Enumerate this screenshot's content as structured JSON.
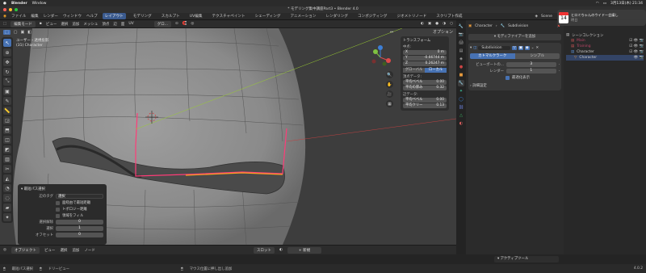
{
  "mac_menu": {
    "app": "Blender",
    "window": "Window",
    "date": "3月13日(木) 21:34"
  },
  "window_title": "* モデリング集中講座Part3 • Blender 4.0",
  "menu": {
    "file": "ファイル",
    "edit": "編集",
    "render": "レンダー",
    "window": "ウィンドウ",
    "help": "ヘルプ"
  },
  "workspaces": [
    "レイアウト",
    "モデリング",
    "スカルプト",
    "UV編集",
    "テクスチャペイント",
    "シェーディング",
    "アニメーション",
    "レンダリング",
    "コンポジティング",
    "ジオメトリノード",
    "スクリプト作成"
  ],
  "active_workspace": 0,
  "scene": "Scene",
  "notification": {
    "day": "14",
    "title": "ヒロミちゃんのウイドー会議し",
    "sub": "明日"
  },
  "viewport_header": {
    "mode": "編集モード",
    "menus": [
      "ビュー",
      "選択",
      "追加",
      "メッシュ",
      "頂点",
      "辺",
      "面",
      "UV"
    ],
    "orientation": "グロ..."
  },
  "viewport_info": {
    "line1": "ユーザー・透視投影",
    "line2": "(31) Character"
  },
  "options_label": "オプション",
  "tools": [
    "cursor",
    "select",
    "move",
    "rotate",
    "scale",
    "transform",
    "annotate",
    "measure",
    "add-cube",
    "extrude",
    "inset",
    "bevel",
    "loopcut",
    "knife",
    "polybuild",
    "spin",
    "smooth",
    "shear",
    "rip"
  ],
  "n_panel": {
    "header": "トランスフォーム",
    "median_label": "中点:",
    "x_label": "X",
    "x_value": "0 m",
    "y_label": "Y",
    "y_value": "-0.66744 m",
    "z_label": "Z",
    "z_value": "0.26247 m",
    "global": "グローバル",
    "local": "ローカル",
    "vertex_data": "頂点データ:",
    "v_bevel_label": "平均ベベル",
    "v_bevel_value": "0.00",
    "v_crease_label": "平均の厚み",
    "v_crease_value": "0.32",
    "edge_data": "辺データ:",
    "e_bevel_label": "平均ベベル",
    "e_bevel_value": "0.00",
    "e_crease_label": "平均クリー",
    "e_crease_value": "0.13"
  },
  "op_panel": {
    "title": "最短パス選択",
    "edge_tag_label": "辺のタグ",
    "edge_tag_value": "選択",
    "opt1": "面経由で最短距離",
    "opt2": "トポロジー距離",
    "opt3": "領域をフィル",
    "deselect_label": "選択解除",
    "deselect_value": "0",
    "select_label": "選択",
    "select_value": "1",
    "offset_label": "オフセット",
    "offset_value": "0"
  },
  "bottom_header": {
    "mode": "オブジェクト",
    "menus": [
      "ビュー",
      "選択",
      "追加",
      "ノード"
    ],
    "slot": "スロット",
    "new": "新規"
  },
  "active_tool": "アクティブツール",
  "status": {
    "item1": "最短パス選択",
    "item2": "ドリービュー",
    "item3": "マウス位置に押し出し追加",
    "version": "4.0.2"
  },
  "properties": {
    "object": "Character",
    "modifier_name": "Subdivision",
    "add_modifier": "モディファイアーを追加",
    "catmull": "カトマルクラーク",
    "simple": "シンプル",
    "levels_viewport_label": "ビューポートの...",
    "levels_viewport_value": "3",
    "render_label": "レンダー",
    "render_value": "1",
    "optimal_label": "最適化表示",
    "advanced": "詳細設定"
  },
  "outliner": {
    "scene_collection": "シーンコレクション",
    "items": [
      "Main",
      "Training",
      "Character",
      "Character"
    ]
  },
  "colors": {
    "accent": "#4772b3",
    "selected_edge_pink": "#ff3c78",
    "selected_edge_orange": "#ffa020",
    "x_axis": "#e04a4a",
    "y_axis": "#7fc241",
    "z_axis": "#3d7fd6"
  }
}
